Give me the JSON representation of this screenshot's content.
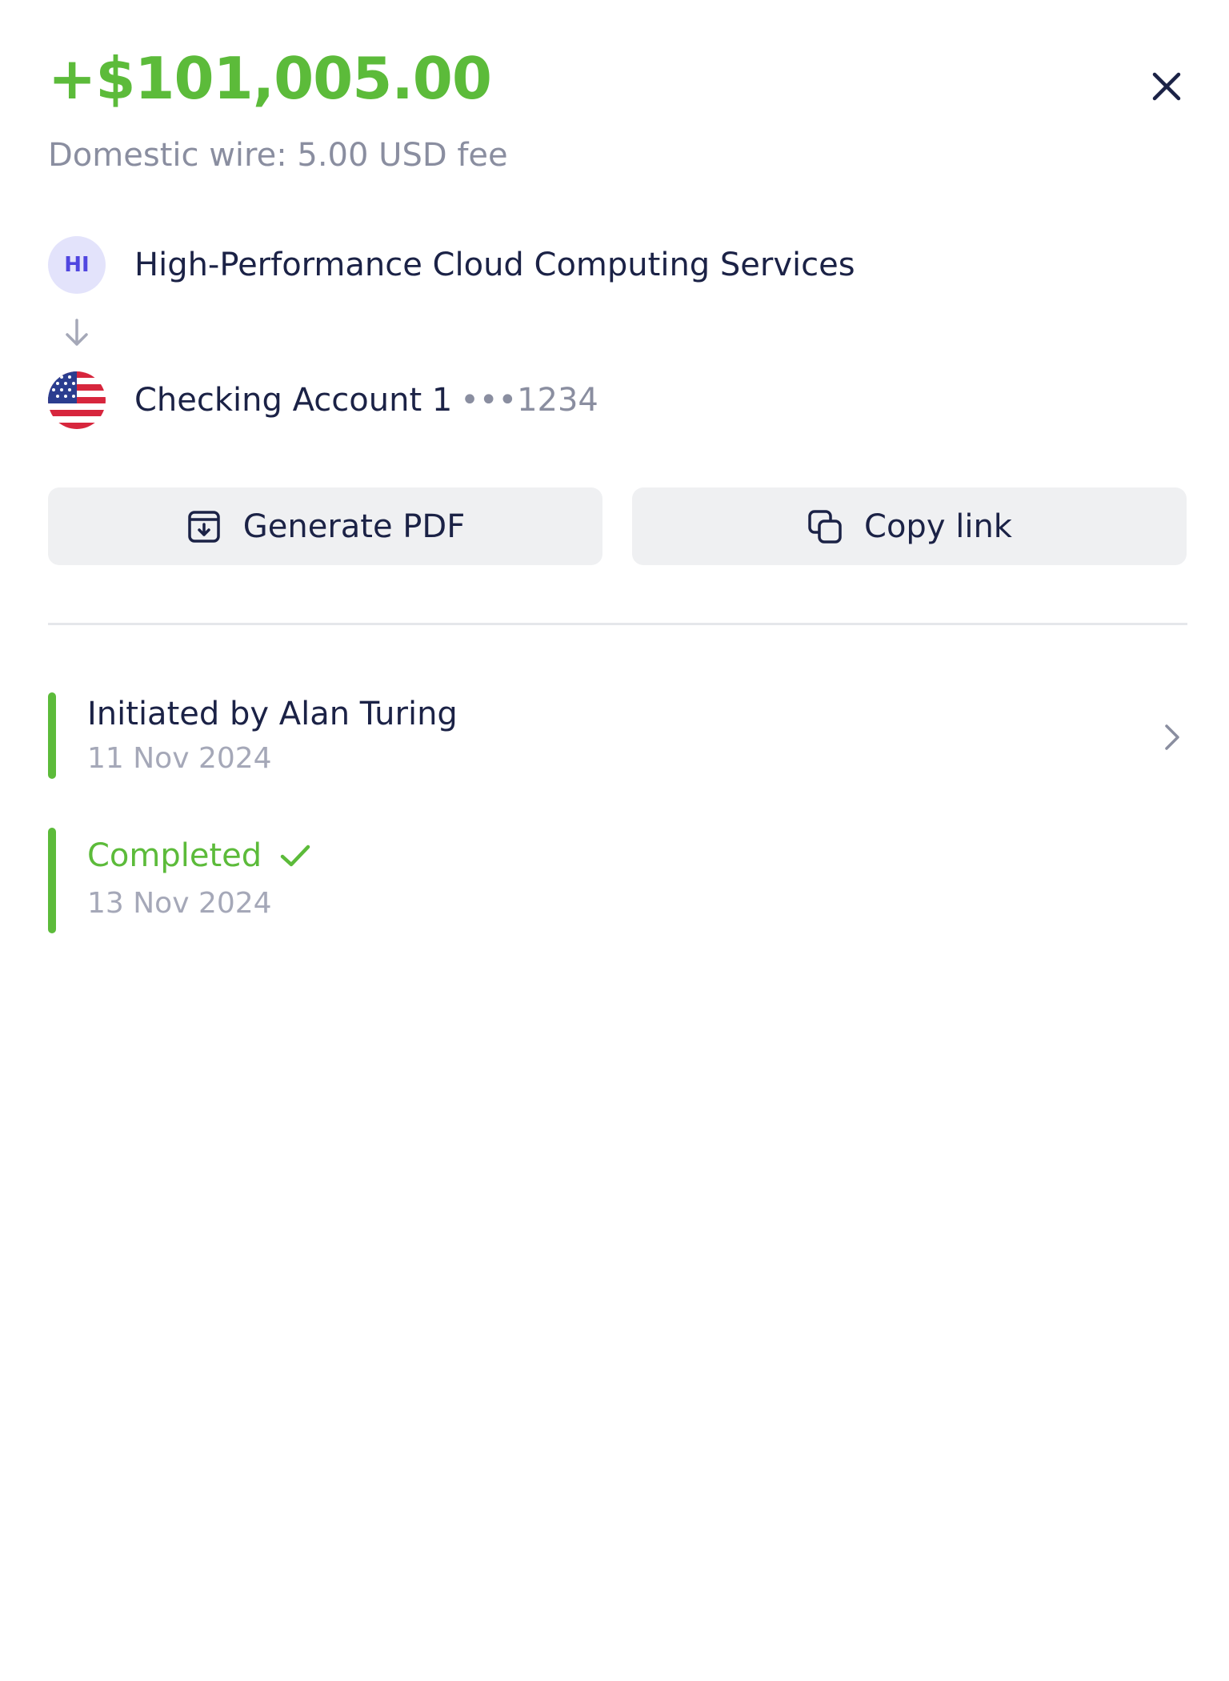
{
  "transaction": {
    "amount": "+$101,005.00",
    "fee_line": "Domestic wire: 5.00 USD fee"
  },
  "from": {
    "initials": "HI",
    "name": "High-Performance Cloud Computing Services"
  },
  "to": {
    "name": "Checking Account 1",
    "mask": "•••1234",
    "flag": "us-flag-icon"
  },
  "actions": {
    "generate_pdf": "Generate PDF",
    "copy_link": "Copy link"
  },
  "timeline": [
    {
      "title": "Initiated by Alan Turing",
      "date": "11 Nov 2024"
    },
    {
      "title": "Completed",
      "date": "13 Nov 2024"
    }
  ],
  "icons": {
    "close": "close-icon",
    "arrow": "arrow-down-icon",
    "pdf": "download-document-icon",
    "copy": "copy-icon",
    "chevron": "chevron-right-icon",
    "check": "check-icon"
  },
  "colors": {
    "accent_green": "#5cbb3a",
    "text_dark": "#1b2246",
    "text_muted": "#8a8ea0",
    "button_bg": "#eff0f2",
    "avatar_bg": "#e3e3fb",
    "avatar_text": "#5046e0"
  }
}
